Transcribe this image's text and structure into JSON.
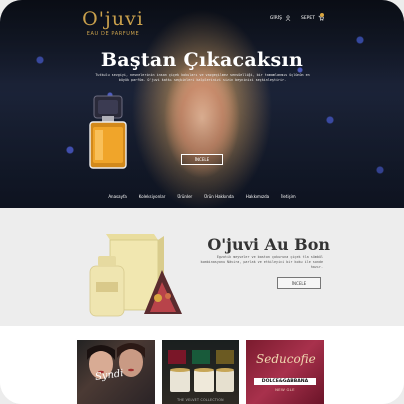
{
  "brand": {
    "name": "O'juvi",
    "tagline": "EAU DE PARFUME"
  },
  "topnav": {
    "account_label": "GİRİŞ",
    "cart_label": "SEPET"
  },
  "hero": {
    "title": "Baştan Çıkacaksın",
    "description": "Tutkulu sevgiyi, nesnelerinin insan çiçek kokuları ve vazgeçilmez sensüelliği, bir tamamlanmıs üçlünün en büyük parfüm. O'juvi katkı seçkinleri kalplerinizi sizin beyninizi seçkinleştirir.",
    "button_label": "İNCELE"
  },
  "menu": {
    "items": [
      "Anasayfa",
      "Koleksiyonlar",
      "Ürünler",
      "Ürün Hakkında",
      "Hakkımızda",
      "İletişim"
    ]
  },
  "featured": {
    "title": "O'juvi Au Bon",
    "description": "Egzotik meyveler ve baston çokuruna çiçek tla sümbül kombinasyonu Nâvira, parlak ve etkileyici bir koku ile sonde hazır.",
    "button_label": "İNCELE"
  },
  "cards": {
    "card1_text": "Syndi",
    "card2_text": "THE VELVET COLLECTION",
    "card3_script": "Seducofie",
    "card3_brand": "DOLCE&GABBANA",
    "card3_sub": "NEW GLE"
  },
  "colors": {
    "gold": "#c9a04c",
    "hero_bg": "#1b2338",
    "band_bg": "#ededed"
  }
}
